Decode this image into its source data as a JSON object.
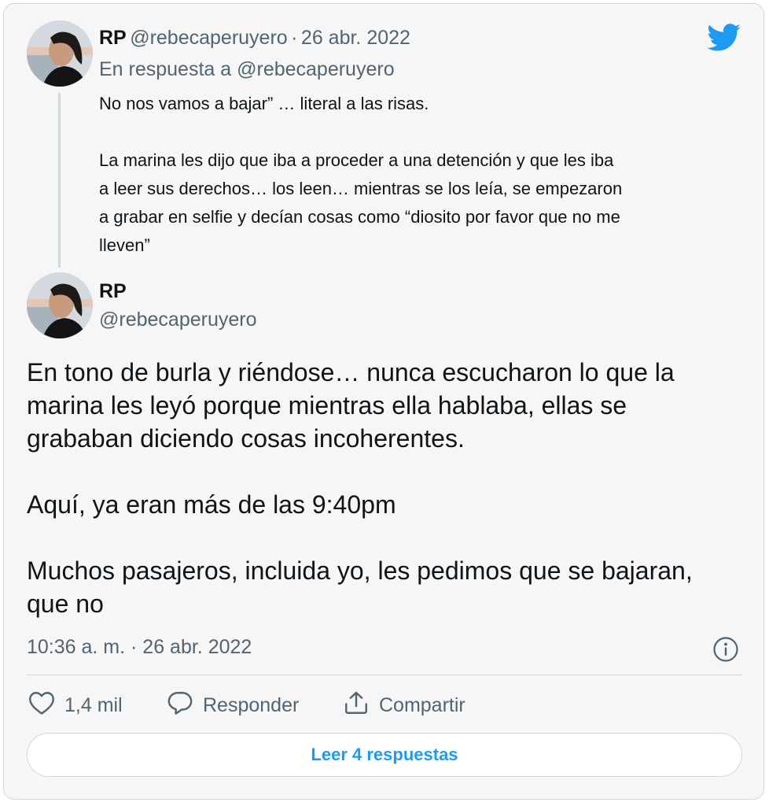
{
  "reply_tweet": {
    "author_name": "RP",
    "author_handle": "@rebecaperuyero",
    "separator": "·",
    "date": "26 abr. 2022",
    "in_reply_to": "En respuesta a @rebecaperuyero",
    "text": "No nos vamos a bajar” … literal a las risas.\n\nLa marina les dijo que iba a proceder a una detención y que les iba\na leer sus derechos… los leen… mientras se los leía, se empezaron\na grabar en selfie y decían cosas como “diosito por favor que no me\nlleven”"
  },
  "main_tweet": {
    "author_name": "RP",
    "author_handle": "@rebecaperuyero",
    "text": "En tono de burla y riéndose… nunca escucharon lo que la\nmarina les leyó porque mientras ella hablaba, ellas se\ngrababan diciendo cosas incoherentes.\n\nAquí, ya eran más de las 9:40pm\n\nMuchos pasajeros, incluida yo, les pedimos que se bajaran,\nque no",
    "timestamp": "10:36 a. m. · 26 abr. 2022"
  },
  "actions": {
    "like_count": "1,4 mil",
    "reply_label": "Responder",
    "share_label": "Compartir"
  },
  "read_replies_label": "Leer 4 respuestas",
  "colors": {
    "twitter_blue": "#1d9bf0",
    "text_primary": "#0f1419",
    "text_secondary": "#536471",
    "border": "#cfd9de"
  },
  "icons": [
    "twitter-bird-icon",
    "info-icon",
    "heart-icon",
    "reply-icon",
    "share-icon"
  ]
}
